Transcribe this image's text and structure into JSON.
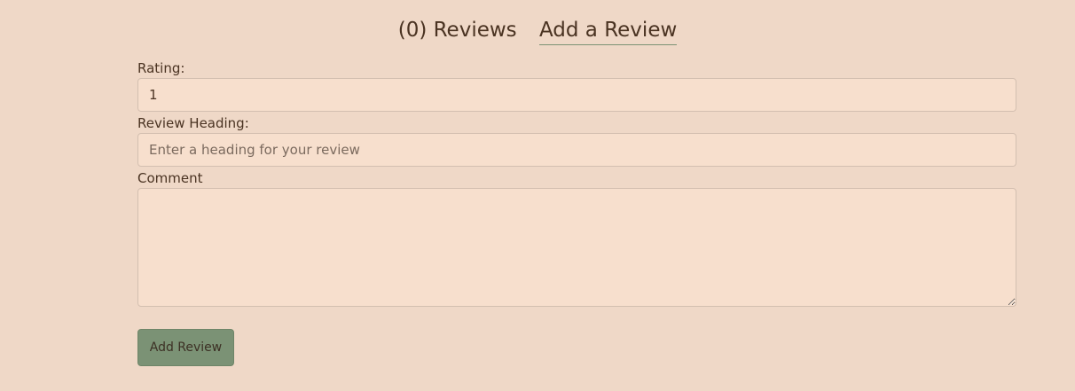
{
  "tabs": {
    "reviews_label": "(0) Reviews",
    "add_label": "Add a Review"
  },
  "form": {
    "rating_label": "Rating:",
    "rating_value": "1",
    "heading_label": "Review Heading:",
    "heading_placeholder": "Enter a heading for your review",
    "comment_label": "Comment",
    "comment_value": ""
  },
  "submit_label": "Add Review",
  "colors": {
    "background": "#efd8c7",
    "field": "#f7dfcd",
    "button": "#7b9275",
    "text": "#4a3322"
  }
}
